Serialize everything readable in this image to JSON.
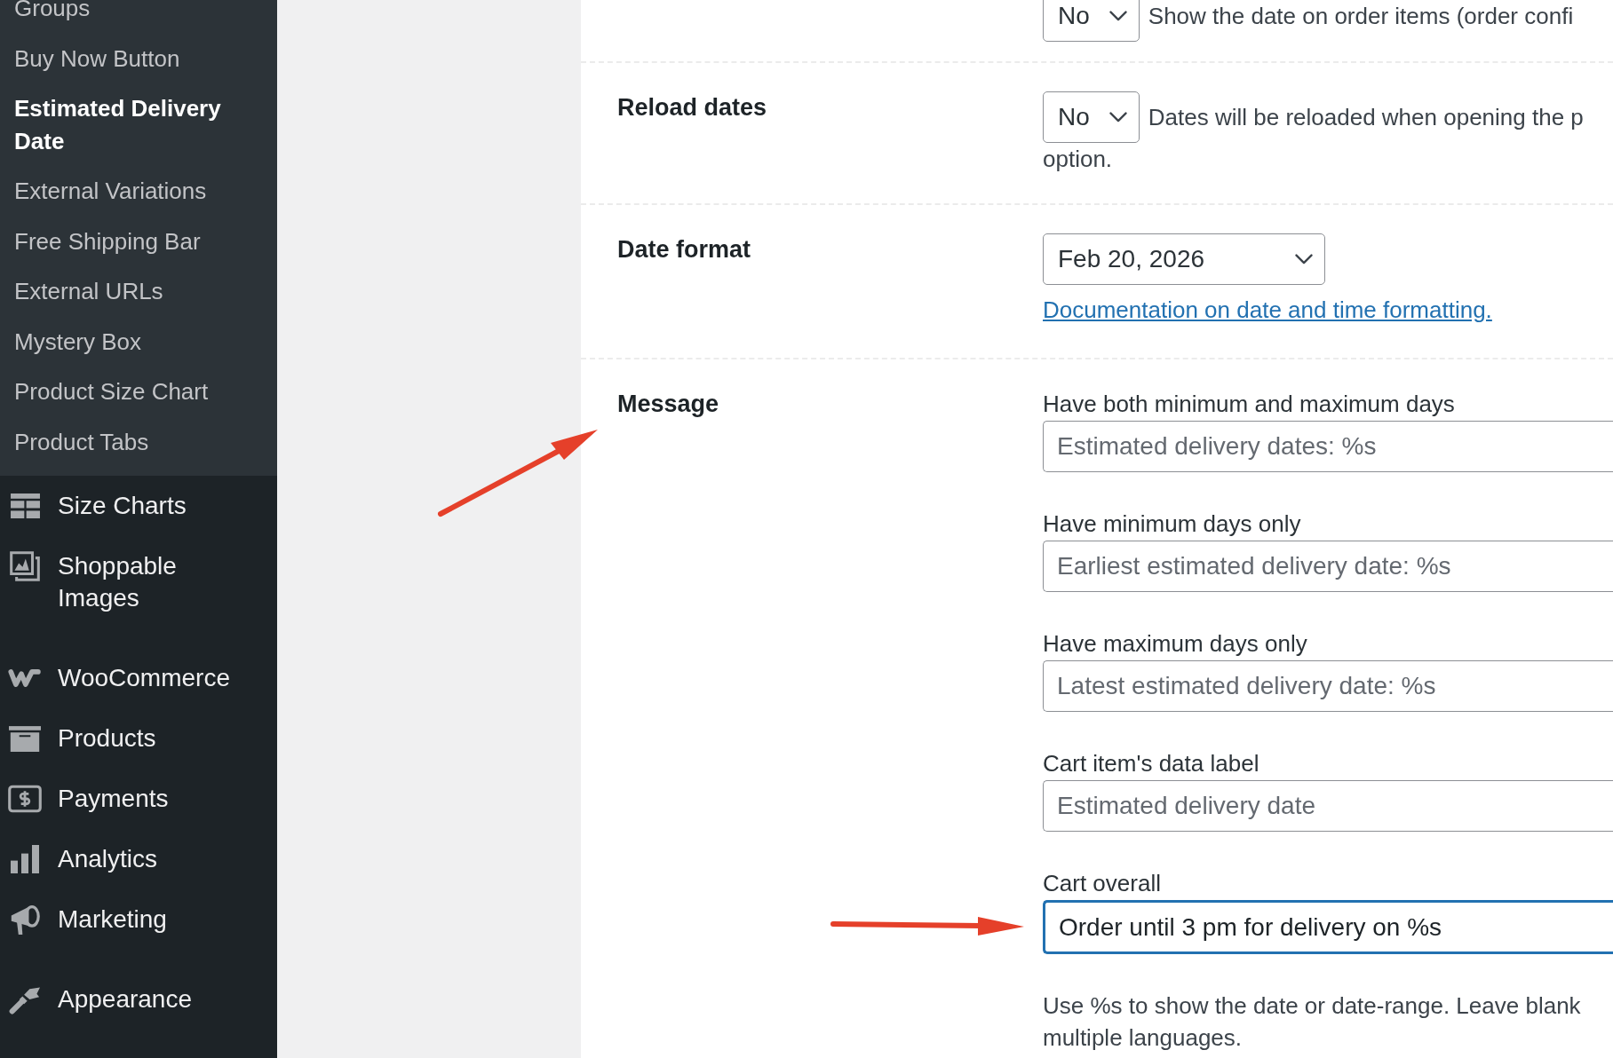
{
  "sidebar": {
    "submenu": [
      {
        "label": "Groups",
        "selected": false
      },
      {
        "label": "Buy Now Button",
        "selected": false
      },
      {
        "label": "Estimated Delivery Date",
        "selected": true
      },
      {
        "label": "External Variations",
        "selected": false
      },
      {
        "label": "Free Shipping Bar",
        "selected": false
      },
      {
        "label": "External URLs",
        "selected": false
      },
      {
        "label": "Mystery Box",
        "selected": false
      },
      {
        "label": "Product Size Chart",
        "selected": false
      },
      {
        "label": "Product Tabs",
        "selected": false
      }
    ],
    "menu_groups": [
      {
        "items": [
          {
            "label": "Size Charts",
            "selected": false
          },
          {
            "label": "Shoppable Images",
            "selected": false
          }
        ]
      },
      {
        "items": [
          {
            "label": "WooCommerce",
            "selected": false
          },
          {
            "label": "Products",
            "selected": false
          },
          {
            "label": "Payments",
            "selected": false
          },
          {
            "label": "Analytics",
            "selected": false
          },
          {
            "label": "Marketing",
            "selected": false
          }
        ]
      },
      {
        "items": [
          {
            "label": "Appearance",
            "selected": false
          }
        ]
      }
    ]
  },
  "settings": {
    "rows": [
      {
        "kind": "select",
        "select_value": "No",
        "description_lines": [
          "Show the date on order items (order confi"
        ]
      },
      {
        "kind": "select",
        "label": "Reload dates",
        "select_value": "No",
        "description_lines": [
          "Dates will be reloaded when opening the p",
          "option."
        ]
      },
      {
        "kind": "format",
        "label": "Date format",
        "select_value": "Feb 20, 2026",
        "link": "Documentation on date and time formatting."
      },
      {
        "kind": "message",
        "label": "Message",
        "fields": [
          {
            "label": "Have both minimum and maximum days",
            "placeholder": "Estimated delivery dates: %s",
            "focused": false
          },
          {
            "label": "Have minimum days only",
            "placeholder": "Earliest estimated delivery date: %s",
            "focused": false
          },
          {
            "label": "Have maximum days only",
            "placeholder": "Latest estimated delivery date: %s",
            "focused": false
          },
          {
            "label": "Cart item's data label",
            "placeholder": "Estimated delivery date",
            "focused": false
          },
          {
            "label": "Cart overall",
            "value": "Order until 3 pm for delivery on %s",
            "focused": true
          }
        ],
        "description_lines": [
          "Use %s to show the date or date-range. Leave blank",
          "multiple languages."
        ]
      }
    ]
  }
}
